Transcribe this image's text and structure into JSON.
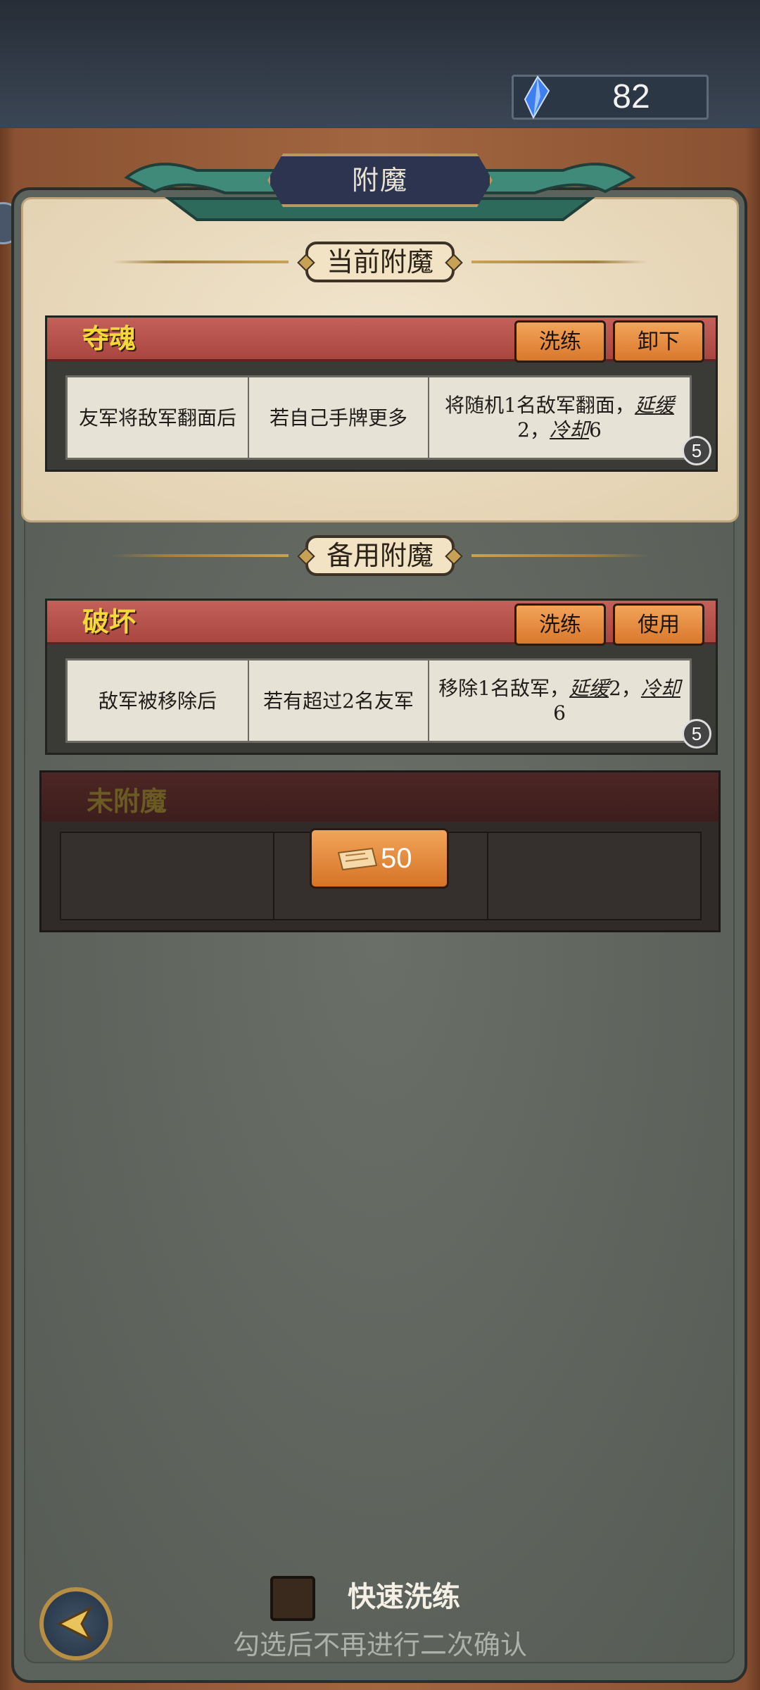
{
  "currency": {
    "icon": "crystal-gem-icon",
    "value": "82"
  },
  "title": "附魔",
  "current_section": {
    "heading": "当前附魔"
  },
  "current_enchant": {
    "name": "夺魂",
    "reroll_label": "洗练",
    "remove_label": "卸下",
    "trigger": "友军将敌军翻面后",
    "condition": "若自己手牌更多",
    "effect_prefix": "将随机1名敌军翻面，",
    "delay_kw": "延缓",
    "delay_val": "2，",
    "cooldown_kw": "冷却",
    "cooldown_val": "6",
    "level": "5"
  },
  "backup_section": {
    "heading": "备用附魔"
  },
  "backup_enchant": {
    "name": "破坏",
    "reroll_label": "洗练",
    "use_label": "使用",
    "trigger": "敌军被移除后",
    "condition": "若有超过2名友军",
    "effect_prefix": "移除1名敌军，",
    "delay_kw": "延缓",
    "delay_val": "2，",
    "cooldown_kw": "冷却",
    "cooldown_val": "6",
    "level": "5"
  },
  "empty_slot": {
    "name": "未附魔",
    "cost_icon": "ticket-icon",
    "cost": "50"
  },
  "footer": {
    "checkbox_label": "快速洗练",
    "checkbox_checked": false,
    "hint": "勾选后不再进行二次确认"
  },
  "colors": {
    "accent": "#d9782c",
    "enchant_name": "#f4d83a",
    "header_red": "#a94640"
  }
}
